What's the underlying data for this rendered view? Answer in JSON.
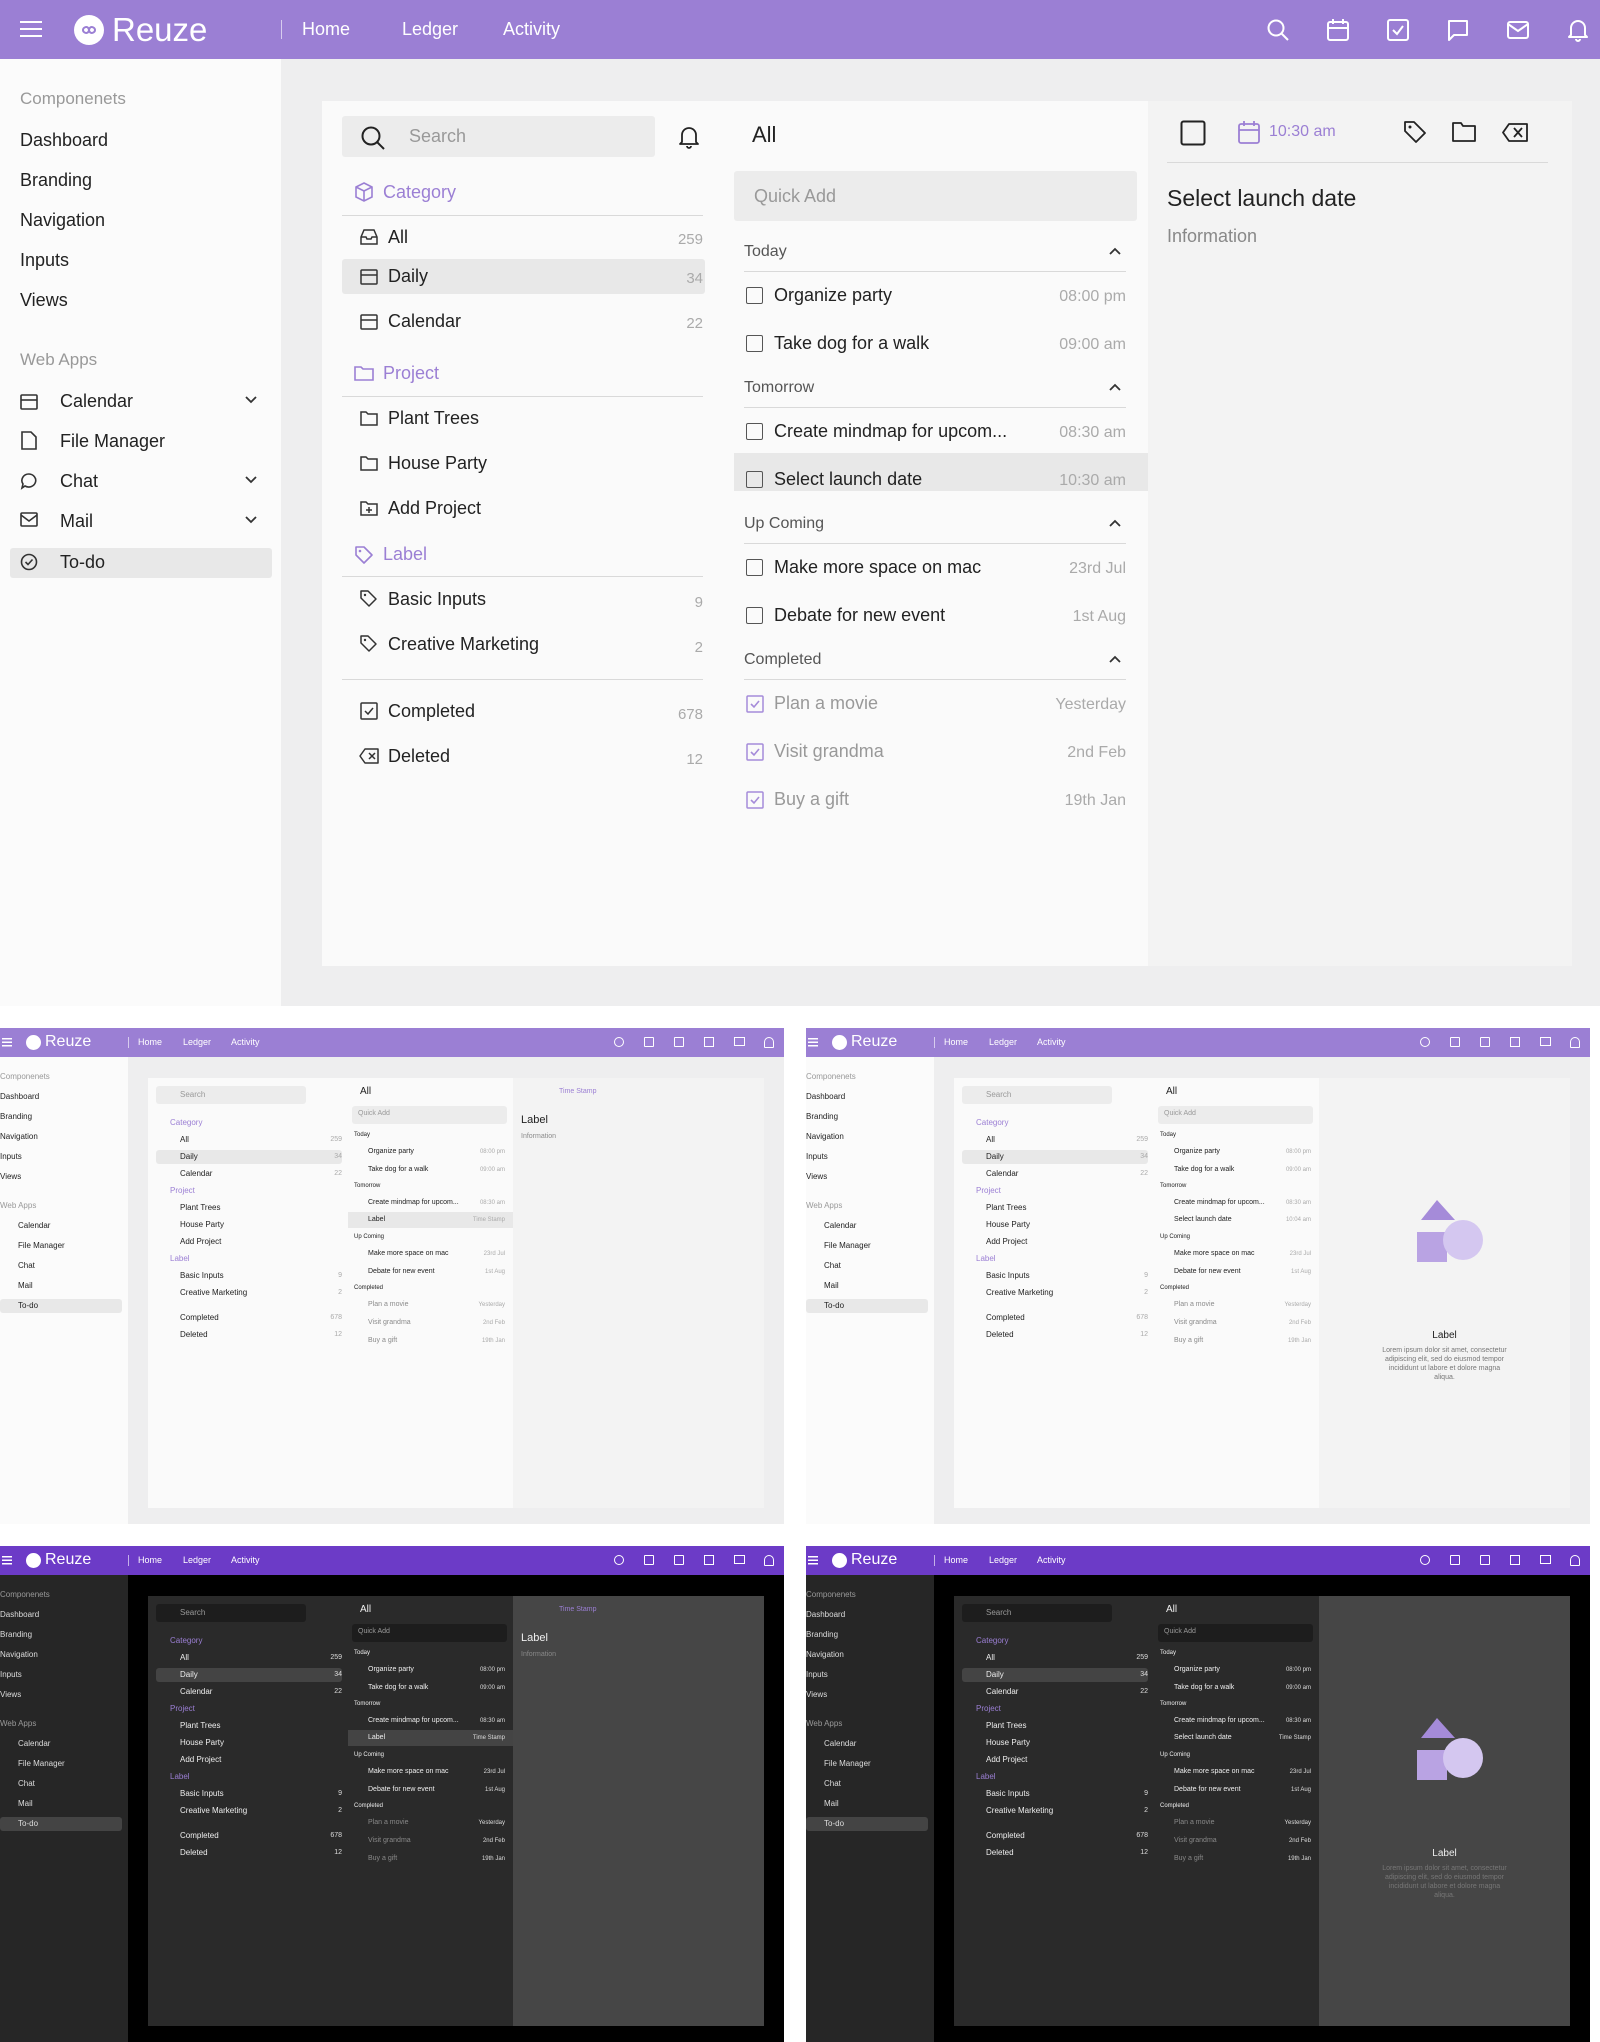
{
  "app": {
    "name": "Reuze"
  },
  "nav": {
    "home": "Home",
    "ledger": "Ledger",
    "activity": "Activity"
  },
  "sidebar": {
    "section1": "Componenets",
    "items1": [
      "Dashboard",
      "Branding",
      "Navigation",
      "Inputs",
      "Views"
    ],
    "section2": "Web Apps",
    "apps": [
      {
        "label": "Calendar",
        "icon": "calendar-icon"
      },
      {
        "label": "File Manager",
        "icon": "file-icon"
      },
      {
        "label": "Chat",
        "icon": "chat-icon"
      },
      {
        "label": "Mail",
        "icon": "mail-icon"
      },
      {
        "label": "To-do",
        "icon": "check-circle-icon"
      }
    ]
  },
  "filters": {
    "search_placeholder": "Search",
    "category_header": "Category",
    "all": "All",
    "all_count": "259",
    "daily": "Daily",
    "daily_count": "34",
    "calendar": "Calendar",
    "calendar_count": "22",
    "project_header": "Project",
    "plant_trees": "Plant Trees",
    "house_party": "House Party",
    "add_project": "Add Project",
    "label_header": "Label",
    "basic_inputs": "Basic Inputs",
    "basic_inputs_count": "9",
    "creative_marketing": "Creative Marketing",
    "creative_marketing_count": "2",
    "completed": "Completed",
    "completed_count": "678",
    "deleted": "Deleted",
    "deleted_count": "12"
  },
  "tasks": {
    "title": "All",
    "quick_add_placeholder": "Quick Add",
    "today": "Today",
    "tomorrow": "Tomorrow",
    "upcoming": "Up Coming",
    "completed": "Completed",
    "t1": "Organize party",
    "t1_time": "08:00 pm",
    "t2": "Take dog for a walk",
    "t2_time": "09:00 am",
    "t3": "Create mindmap for upcom...",
    "t3_time": "08:30 am",
    "t4": "Select launch date",
    "t4_time": "10:30 am",
    "t5": "Make more space on mac",
    "t5_time": "23rd Jul",
    "t6": "Debate for new event",
    "t6_time": "1st Aug",
    "t7": "Plan a movie",
    "t7_time": "Yesterday",
    "t8": "Visit grandma",
    "t8_time": "2nd Feb",
    "t9": "Buy a gift",
    "t9_time": "19th Jan"
  },
  "detail": {
    "time": "10:30 am",
    "title": "Select launch date",
    "info": "Information"
  },
  "variants": {
    "label_task": "Label",
    "label_time": "Time Stamp",
    "selected_time_light": "10:04 am",
    "detail_title": "Label",
    "detail_info": "Information",
    "empty_title": "Label",
    "empty_text": "Lorem ipsum dolor sit amet, consectetur adipiscing elit, sed do eiusmod tempor incididunt ut labore et dolore magna aliqua."
  },
  "colors": {
    "accent": "#9b7fd4",
    "accent_dark": "#6c3bc7"
  }
}
